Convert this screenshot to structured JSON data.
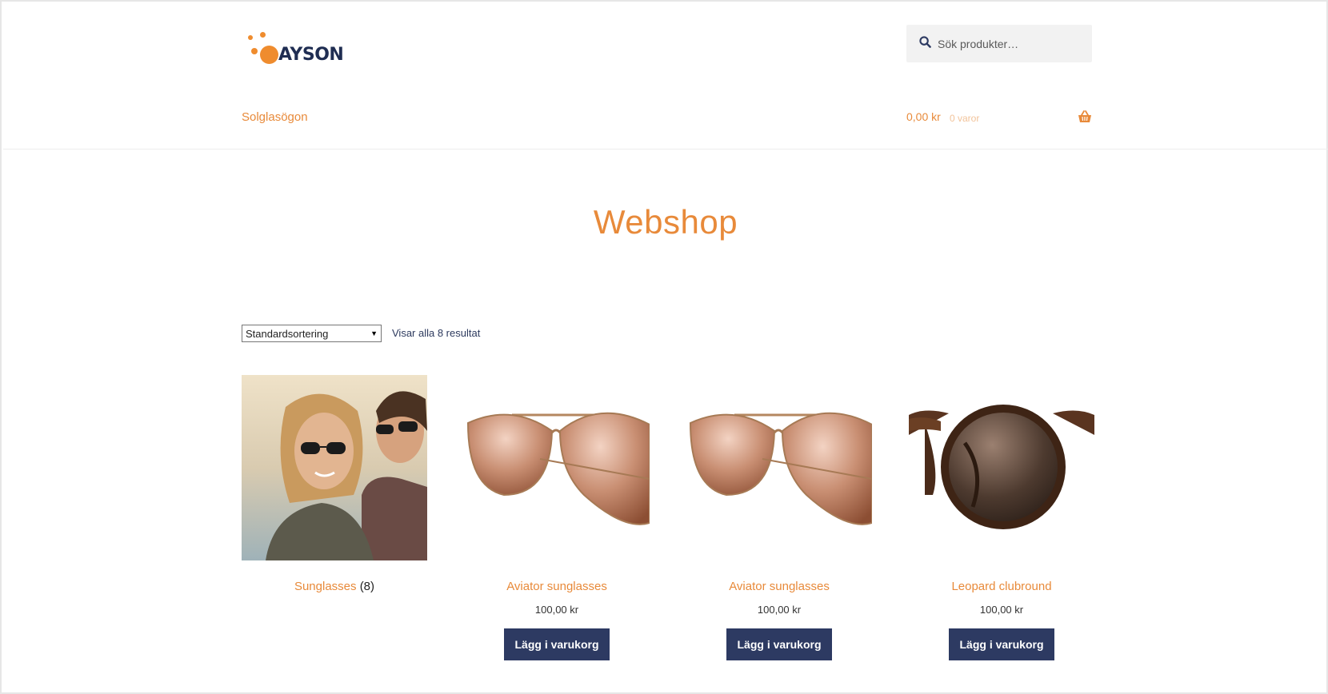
{
  "brand": {
    "logo_text": "AYSON",
    "accent": "#e88a3a",
    "navy": "#2d3a62"
  },
  "search": {
    "placeholder": "Sök produkter…",
    "icon": "search-icon"
  },
  "nav": {
    "item": "Solglasögon"
  },
  "cart": {
    "amount": "0,00 kr",
    "count": "0 varor",
    "icon": "basket-icon"
  },
  "page": {
    "title": "Webshop"
  },
  "toolbar": {
    "sort_selected": "Standardsortering",
    "result_text": "Visar alla 8 resultat"
  },
  "category": {
    "name": "Sunglasses",
    "count": "(8)"
  },
  "products": [
    {
      "title": "Aviator sunglasses",
      "price": "100,00 kr",
      "button": "Lägg i varukorg"
    },
    {
      "title": "Aviator sunglasses",
      "price": "100,00 kr",
      "button": "Lägg i varukorg"
    },
    {
      "title": "Leopard clubround",
      "price": "100,00 kr",
      "button": "Lägg i varukorg"
    }
  ]
}
